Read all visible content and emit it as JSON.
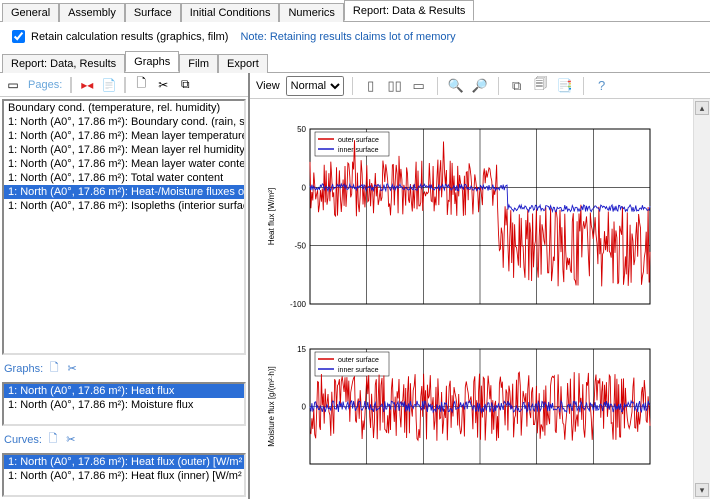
{
  "main_tabs": [
    "General",
    "Assembly",
    "Surface",
    "Initial Conditions",
    "Numerics",
    "Report: Data & Results"
  ],
  "main_tab_active": 5,
  "retain": {
    "label": "Retain calculation results (graphics, film)",
    "checked": true,
    "note": "Note: Retaining results claims lot of memory"
  },
  "sub_tabs": [
    "Report: Data, Results",
    "Graphs",
    "Film",
    "Export"
  ],
  "sub_tab_active": 1,
  "left": {
    "pages_label": "Pages:",
    "pages_items": [
      {
        "label": "Boundary cond. (temperature, rel. humidity)",
        "selected": false
      },
      {
        "label": "1: North (A0°, 17.86 m²): Boundary cond. (rain, sc",
        "selected": false
      },
      {
        "label": "1: North (A0°, 17.86 m²): Mean layer temperature",
        "selected": false
      },
      {
        "label": "1: North (A0°, 17.86 m²): Mean layer rel humidity",
        "selected": false
      },
      {
        "label": "1: North (A0°, 17.86 m²): Mean layer water conte",
        "selected": false
      },
      {
        "label": "1: North (A0°, 17.86 m²): Total water content",
        "selected": false
      },
      {
        "label": "1: North (A0°, 17.86 m²): Heat-/Moisture fluxes o",
        "selected": true
      },
      {
        "label": "1: North (A0°, 17.86 m²): Isopleths (interior surfac",
        "selected": false
      }
    ],
    "graphs_label": "Graphs:",
    "graphs_items": [
      {
        "label": "1: North (A0°, 17.86 m²): Heat flux",
        "selected": true
      },
      {
        "label": "1: North (A0°, 17.86 m²): Moisture flux",
        "selected": false
      }
    ],
    "curves_label": "Curves:",
    "curves_items": [
      {
        "label": "1: North (A0°, 17.86 m²): Heat flux (outer) [W/m²",
        "selected": true
      },
      {
        "label": "1: North (A0°, 17.86 m²): Heat flux (inner) [W/m²",
        "selected": false
      }
    ]
  },
  "right": {
    "view_label": "View",
    "view_options": [
      "Normal"
    ],
    "view_selected": "Normal"
  },
  "chart_data": [
    {
      "type": "line",
      "title": "",
      "ylabel": "Heat flux [W/m²]",
      "ylim": [
        -100,
        50
      ],
      "yticks": [
        -100,
        -50,
        0,
        50
      ],
      "xlim": [
        0,
        6
      ],
      "legend": [
        "outer surface",
        "inner surface"
      ],
      "series": [
        {
          "name": "outer surface",
          "color": "#d40000",
          "approx_note": "noisy red line oscillating around 0 for first half, spikes up to ~40, then dropping to oscillate around -50 with large noise (range about -90 to -10)"
        },
        {
          "name": "inner surface",
          "color": "#1a1ac8",
          "approx_note": "blue line near 0 with small noise for first ~60%, then stepping down to about -18 and staying roughly flat with small oscillation"
        }
      ]
    },
    {
      "type": "line",
      "title": "",
      "ylabel": "Moisture flux [g/(m²·h)]",
      "ylim": [
        -15,
        15
      ],
      "yticks": [
        0,
        15
      ],
      "xlim": [
        0,
        6
      ],
      "legend": [
        "outer surface",
        "inner surface"
      ],
      "series": [
        {
          "name": "outer surface",
          "color": "#d40000",
          "approx_note": "dense noisy red oscillations roughly ±10 around zero across full span"
        },
        {
          "name": "inner surface",
          "color": "#1a1ac8",
          "approx_note": "blue line staying close to 0 with small noise across full span"
        }
      ]
    }
  ]
}
